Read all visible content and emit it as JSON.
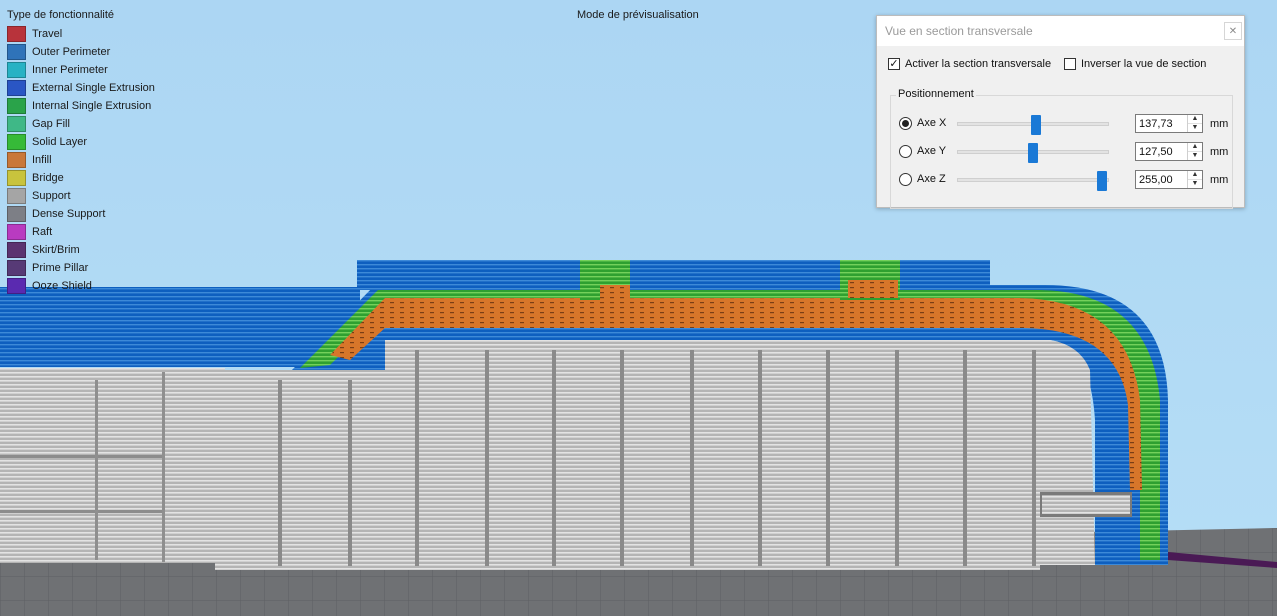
{
  "legend": {
    "title": "Type de fonctionnalité",
    "items": [
      {
        "label": "Travel",
        "color": "#b8333b"
      },
      {
        "label": "Outer Perimeter",
        "color": "#2f73b9"
      },
      {
        "label": "Inner Perimeter",
        "color": "#27b2c4"
      },
      {
        "label": "External Single Extrusion",
        "color": "#2a56c4"
      },
      {
        "label": "Internal Single Extrusion",
        "color": "#2aa34a"
      },
      {
        "label": "Gap Fill",
        "color": "#3fb887"
      },
      {
        "label": "Solid Layer",
        "color": "#36ba38"
      },
      {
        "label": "Infill",
        "color": "#c9783a"
      },
      {
        "label": "Bridge",
        "color": "#c8c33d"
      },
      {
        "label": "Support",
        "color": "#a5a5a5"
      },
      {
        "label": "Dense Support",
        "color": "#7d7f86"
      },
      {
        "label": "Raft",
        "color": "#b93bc0"
      },
      {
        "label": "Skirt/Brim",
        "color": "#5c3370"
      },
      {
        "label": "Prime Pillar",
        "color": "#573a76"
      },
      {
        "label": "Ooze Shield",
        "color": "#5a2ab0"
      }
    ]
  },
  "mode_label": "Mode de prévisualisation",
  "dialog": {
    "title": "Vue en section transversale",
    "close_glyph": "✕",
    "enable_section": {
      "label": "Activer la section transversale",
      "checked": true
    },
    "invert_section": {
      "label": "Inverser la vue de section",
      "checked": false
    },
    "group_label": "Positionnement",
    "axes": [
      {
        "label": "Axe X",
        "selected": true,
        "value": "137,73",
        "level": 0.52,
        "unit": "mm"
      },
      {
        "label": "Axe Y",
        "selected": false,
        "value": "127,50",
        "level": 0.5,
        "unit": "mm"
      },
      {
        "label": "Axe Z",
        "selected": false,
        "value": "255,00",
        "level": 0.96,
        "unit": "mm"
      }
    ]
  },
  "colors": {
    "sky": "#a9d4f2",
    "floor": "#6f7072",
    "perimeter": "#1566c0",
    "support": "#c8c8c8",
    "infill": "#d9792a",
    "solid": "#2fa82f",
    "slider": "#1a79d6"
  }
}
